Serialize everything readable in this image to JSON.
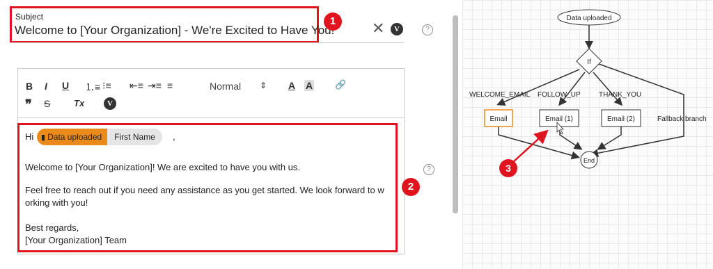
{
  "subject": {
    "label": "Subject",
    "value": "Welcome to [Your Organization] - We're Excited to Have You!",
    "clear_icon": "close-icon",
    "variable_icon": "V"
  },
  "badges": [
    "1",
    "2",
    "3"
  ],
  "help_icon": "?",
  "toolbar": {
    "bold": "B",
    "italic": "I",
    "underline": "U",
    "ordered_list": "⒈≡",
    "bullet_list": "⁝≡",
    "outdent": "⇤≡",
    "indent": "⇥≡",
    "align": "≡",
    "heading_select": "Normal",
    "select_arrow": "⇕",
    "text_color": "A",
    "background_color": "A",
    "link": "🔗",
    "blockquote": "❞",
    "strike": "S",
    "clear_format": "Tx",
    "variable": "V"
  },
  "content": {
    "greeting": "Hi",
    "chip_source": "Data uploaded",
    "chip_field": "First Name",
    "comma": ",",
    "paragraph1": "Welcome to [Your Organization]! We are excited to have you with us.",
    "paragraph2_line1": "Feel free to reach out if you need any assistance as you get started. We look forward to w",
    "paragraph2_line2": "orking with you!",
    "signoff": "Best regards,",
    "signature": "[Your Organization] Team"
  },
  "flow": {
    "start": "Data uploaded",
    "decision": "If",
    "branches": [
      "WELCOME_EMAIL",
      "FOLLOW_UP",
      "THANK_YOU",
      "Fallback branch"
    ],
    "nodes": [
      "Email",
      "Email (1)",
      "Email (2)"
    ],
    "end": "End"
  },
  "colors": {
    "highlight": "#e0141e",
    "chip_orange": "#ea8a1b",
    "selected_node": "#ea8a1b"
  }
}
